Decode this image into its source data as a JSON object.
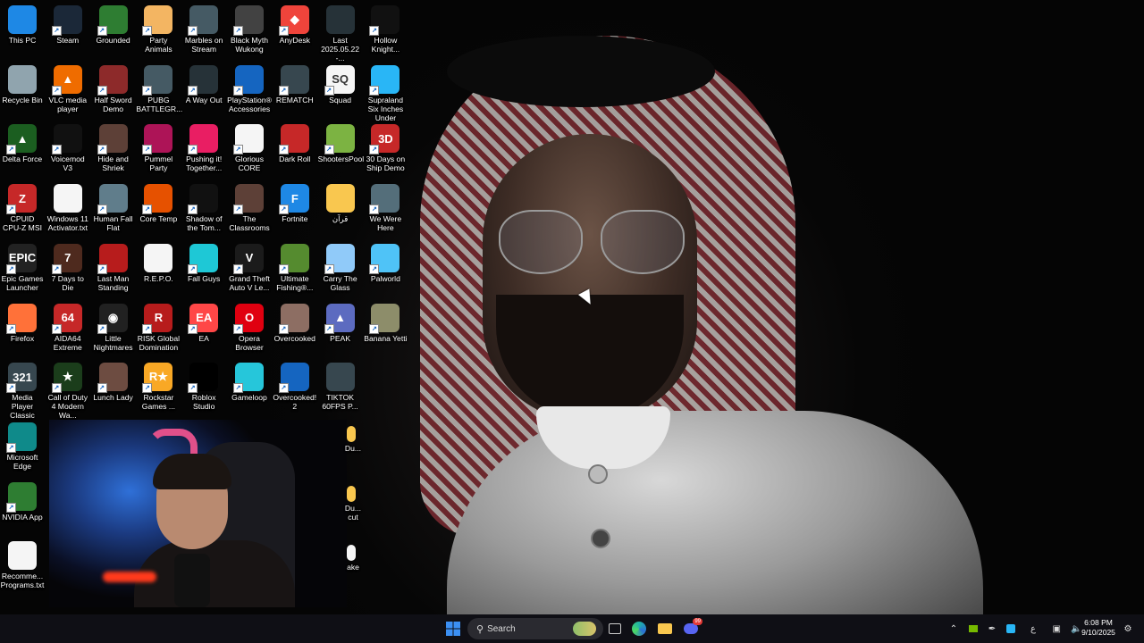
{
  "desktop": {
    "columns": [
      [
        {
          "label": "This PC",
          "icon": "monitor-icon",
          "color": "#1e88e5",
          "glyph": "",
          "shortcut": false
        },
        {
          "label": "Recycle Bin",
          "icon": "recycle-bin-icon",
          "color": "#90a4ae",
          "glyph": "",
          "shortcut": false
        },
        {
          "label": "Delta Force",
          "icon": "delta-force-icon",
          "color": "#1b5e20",
          "glyph": "▲",
          "shortcut": true
        },
        {
          "label": "CPUID CPU-Z MSI",
          "icon": "cpu-z-icon",
          "color": "#c62828",
          "glyph": "Z",
          "shortcut": true
        },
        {
          "label": "Epic Games Launcher",
          "icon": "epic-games-icon",
          "color": "#222222",
          "glyph": "EPIC",
          "shortcut": true
        },
        {
          "label": "Firefox",
          "icon": "firefox-icon",
          "color": "#ff7139",
          "glyph": "",
          "shortcut": true
        },
        {
          "label": "Media Player Classic",
          "icon": "media-player-icon",
          "color": "#37474f",
          "glyph": "321",
          "shortcut": true
        },
        {
          "label": "Microsoft Edge",
          "icon": "edge-icon",
          "color": "#0f8a8a",
          "glyph": "",
          "shortcut": true
        },
        {
          "label": "NVIDIA App",
          "icon": "nvidia-icon",
          "color": "#2e7d32",
          "glyph": "",
          "shortcut": true
        },
        {
          "label": "Recomme... Programs.txt",
          "icon": "text-file-icon",
          "color": "#f5f5f5",
          "glyph": "",
          "shortcut": false
        }
      ],
      [
        {
          "label": "Steam",
          "icon": "steam-icon",
          "color": "#1b2838",
          "glyph": "",
          "shortcut": true
        },
        {
          "label": "VLC media player",
          "icon": "vlc-icon",
          "color": "#ef6c00",
          "glyph": "▲",
          "shortcut": true
        },
        {
          "label": "Voicemod V3",
          "icon": "voicemod-icon",
          "color": "#111111",
          "glyph": "",
          "shortcut": true
        },
        {
          "label": "Windows 11 Activator.txt",
          "icon": "text-file-icon",
          "color": "#f5f5f5",
          "glyph": "",
          "shortcut": false
        },
        {
          "label": "7 Days to Die",
          "icon": "7-days-icon",
          "color": "#4e2a1e",
          "glyph": "7",
          "shortcut": true
        },
        {
          "label": "AIDA64 Extreme",
          "icon": "aida64-icon",
          "color": "#c62828",
          "glyph": "64",
          "shortcut": true
        },
        {
          "label": "Call of Duty 4 Modern Wa...",
          "icon": "cod4-icon",
          "color": "#1b3d1b",
          "glyph": "★",
          "shortcut": true
        }
      ],
      [
        {
          "label": "Grounded",
          "icon": "grounded-icon",
          "color": "#2e7d32",
          "glyph": "",
          "shortcut": true
        },
        {
          "label": "Half Sword Demo",
          "icon": "half-sword-icon",
          "color": "#8d2a2a",
          "glyph": "",
          "shortcut": true
        },
        {
          "label": "Hide and Shriek",
          "icon": "hide-and-shriek-icon",
          "color": "#5d4037",
          "glyph": "",
          "shortcut": true
        },
        {
          "label": "Human Fall Flat",
          "icon": "human-fall-flat-icon",
          "color": "#607d8b",
          "glyph": "",
          "shortcut": true
        },
        {
          "label": "Last Man Standing",
          "icon": "last-man-standing-icon",
          "color": "#b71c1c",
          "glyph": "",
          "shortcut": true
        },
        {
          "label": "Little Nightmares",
          "icon": "little-nightmares-icon",
          "color": "#212121",
          "glyph": "◉",
          "shortcut": true
        },
        {
          "label": "Lunch Lady",
          "icon": "lunch-lady-icon",
          "color": "#6d4c41",
          "glyph": "",
          "shortcut": true
        }
      ],
      [
        {
          "label": "Party Animals",
          "icon": "party-animals-icon",
          "color": "#f3b562",
          "glyph": "",
          "shortcut": true
        },
        {
          "label": "PUBG BATTLEGR...",
          "icon": "pubg-icon",
          "color": "#455a64",
          "glyph": "",
          "shortcut": true
        },
        {
          "label": "Pummel Party",
          "icon": "pummel-party-icon",
          "color": "#ad1457",
          "glyph": "",
          "shortcut": true
        },
        {
          "label": "Core Temp",
          "icon": "core-temp-icon",
          "color": "#e65100",
          "glyph": "",
          "shortcut": true
        },
        {
          "label": "R.E.P.O.",
          "icon": "blank-file-icon",
          "color": "#f5f5f5",
          "glyph": "",
          "shortcut": false
        },
        {
          "label": "RISK Global Domination",
          "icon": "risk-icon",
          "color": "#b71c1c",
          "glyph": "R",
          "shortcut": true
        },
        {
          "label": "Rockstar Games ...",
          "icon": "rockstar-icon",
          "color": "#f9a825",
          "glyph": "R★",
          "shortcut": true
        }
      ],
      [
        {
          "label": "Marbles on Stream",
          "icon": "marbles-icon",
          "color": "#455a64",
          "glyph": "",
          "shortcut": true
        },
        {
          "label": "A Way Out",
          "icon": "a-way-out-icon",
          "color": "#263238",
          "glyph": "",
          "shortcut": true
        },
        {
          "label": "Pushing it! Together...",
          "icon": "pushing-it-icon",
          "color": "#e91e63",
          "glyph": "",
          "shortcut": true
        },
        {
          "label": "Shadow of the Tom...",
          "icon": "shadow-tomb-raider-icon",
          "color": "#111111",
          "glyph": "",
          "shortcut": true
        },
        {
          "label": "Fall Guys",
          "icon": "fall-guys-icon",
          "color": "#1ec8d6",
          "glyph": "",
          "shortcut": true
        },
        {
          "label": "EA",
          "icon": "ea-icon",
          "color": "#ff4747",
          "glyph": "EA",
          "shortcut": true
        },
        {
          "label": "Roblox Studio",
          "icon": "roblox-studio-icon",
          "color": "#000000",
          "glyph": "",
          "shortcut": true
        }
      ],
      [
        {
          "label": "Black Myth Wukong",
          "icon": "black-myth-icon",
          "color": "#424242",
          "glyph": "",
          "shortcut": true
        },
        {
          "label": "PlayStation® Accessories",
          "icon": "playstation-icon",
          "color": "#1565c0",
          "glyph": "",
          "shortcut": true
        },
        {
          "label": "Glorious CORE",
          "icon": "glorious-icon",
          "color": "#f5f5f5",
          "glyph": "",
          "shortcut": true
        },
        {
          "label": "The Classrooms",
          "icon": "classrooms-icon",
          "color": "#5d4037",
          "glyph": "",
          "shortcut": true
        },
        {
          "label": "Grand Theft Auto V Le...",
          "icon": "gta-v-icon",
          "color": "#1b1b1b",
          "glyph": "V",
          "shortcut": true
        },
        {
          "label": "Opera Browser",
          "icon": "opera-icon",
          "color": "#e00010",
          "glyph": "O",
          "shortcut": true
        },
        {
          "label": "Gameloop",
          "icon": "gameloop-icon",
          "color": "#26c6da",
          "glyph": "",
          "shortcut": true
        }
      ],
      [
        {
          "label": "AnyDesk",
          "icon": "anydesk-icon",
          "color": "#ef443b",
          "glyph": "◆",
          "shortcut": true
        },
        {
          "label": "REMATCH",
          "icon": "rematch-icon",
          "color": "#37474f",
          "glyph": "",
          "shortcut": true
        },
        {
          "label": "Dark Roll",
          "icon": "dark-roll-icon",
          "color": "#c62828",
          "glyph": "",
          "shortcut": true
        },
        {
          "label": "Fortnite",
          "icon": "fortnite-icon",
          "color": "#1e88e5",
          "glyph": "F",
          "shortcut": true
        },
        {
          "label": "Ultimate Fishing®...",
          "icon": "fishing-icon",
          "color": "#558b2f",
          "glyph": "",
          "shortcut": true
        },
        {
          "label": "Overcooked",
          "icon": "overcooked-icon",
          "color": "#8d6e63",
          "glyph": "",
          "shortcut": true
        },
        {
          "label": "Overcooked! 2",
          "icon": "overcooked-2-icon",
          "color": "#1565c0",
          "glyph": "",
          "shortcut": true
        }
      ],
      [
        {
          "label": "Last 2025.05.22 -...",
          "icon": "video-file-icon",
          "color": "#263238",
          "glyph": "",
          "shortcut": false
        },
        {
          "label": "Squad",
          "icon": "squad-icon",
          "color": "#f5f5f5",
          "glyph": "SQ",
          "shortcut": true
        },
        {
          "label": "ShootersPool",
          "icon": "shooterspool-icon",
          "color": "#7cb342",
          "glyph": "",
          "shortcut": true
        },
        {
          "label": "قرآن",
          "icon": "folder-icon",
          "color": "#f9c74f",
          "glyph": "",
          "shortcut": false
        },
        {
          "label": "Carry The Glass",
          "icon": "carry-the-glass-icon",
          "color": "#90caf9",
          "glyph": "",
          "shortcut": true
        },
        {
          "label": "PEAK",
          "icon": "peak-icon",
          "color": "#5c6bc0",
          "glyph": "▲",
          "shortcut": true
        },
        {
          "label": "TIKTOK 60FPS P...",
          "icon": "tiktok-video-icon",
          "color": "#37474f",
          "glyph": "",
          "shortcut": false
        }
      ],
      [
        {
          "label": "Hollow Knight...",
          "icon": "hollow-knight-icon",
          "color": "#111111",
          "glyph": "",
          "shortcut": true
        },
        {
          "label": "Supraland Six Inches Under",
          "icon": "supraland-icon",
          "color": "#29b6f6",
          "glyph": "",
          "shortcut": true
        },
        {
          "label": "30 Days on Ship Demo",
          "icon": "30-days-icon",
          "color": "#c62828",
          "glyph": "3D",
          "shortcut": true
        },
        {
          "label": "We Were Here",
          "icon": "we-were-here-icon",
          "color": "#546e7a",
          "glyph": "",
          "shortcut": true
        },
        {
          "label": "Palworld",
          "icon": "palworld-icon",
          "color": "#4fc3f7",
          "glyph": "",
          "shortcut": true
        },
        {
          "label": "Banana Yetti",
          "icon": "banana-yetti-icon",
          "color": "#8d8d6a",
          "glyph": "",
          "shortcut": true
        }
      ]
    ],
    "partial_labels": [
      "Du...",
      "Du... cut",
      "ake"
    ]
  },
  "taskbar": {
    "search_placeholder": "Search",
    "tray_language": "ع",
    "time": "6:08 PM",
    "date": "9/10/2025",
    "discord_badge": "99"
  },
  "colors": {
    "taskbar_bg": "#0f0f15",
    "start_blue": "#3b8ff3",
    "accent_green": "#76b900"
  }
}
